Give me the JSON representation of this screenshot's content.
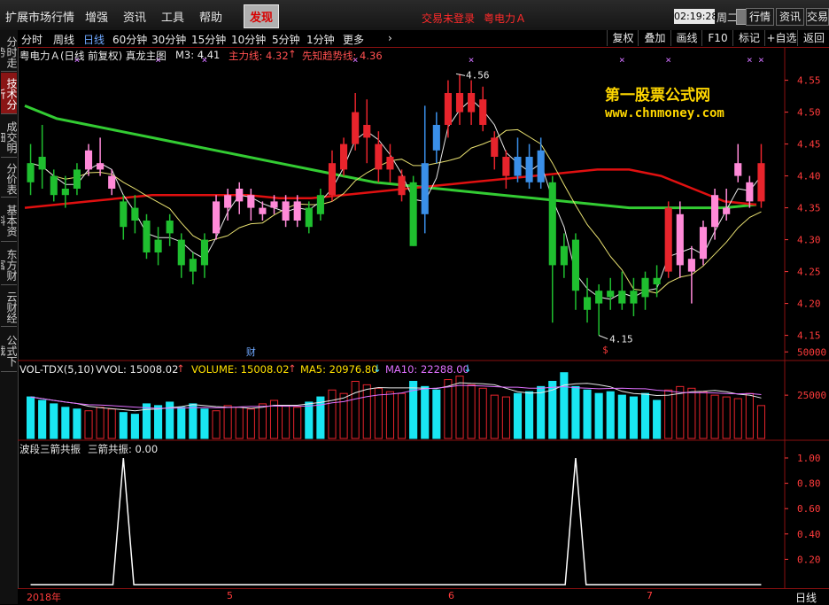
{
  "menu": {
    "items": [
      {
        "label": "扩展市场行情",
        "x": 6
      },
      {
        "label": "增强",
        "x": 96
      },
      {
        "label": "资讯",
        "x": 139
      },
      {
        "label": "工具",
        "x": 182
      },
      {
        "label": "帮助",
        "x": 225
      }
    ],
    "active_label": "发现",
    "status_not_logged": "交易未登录",
    "status_stock": "粤电力Ａ",
    "clock": "02:19:28",
    "weekday": "周二",
    "buttons": [
      "行情",
      "资讯",
      "交易"
    ]
  },
  "periods": {
    "items": [
      "分时",
      "周线",
      "日线",
      "60分钟",
      "30分钟",
      "15分钟",
      "10分钟",
      "5分钟",
      "1分钟",
      "更多"
    ],
    "selected": "日线",
    "more_arrow": "›",
    "tools": [
      "复权",
      "叠加",
      "画线",
      "F10",
      "标记",
      "+自选",
      "返回"
    ]
  },
  "left_tabs": [
    "分时走势",
    "技术分析",
    "成交明细",
    "分价表",
    "基本资料",
    "东方财富",
    "云财经",
    "公式下载"
  ],
  "left_tab_selected": "技术分析",
  "main_panel": {
    "title": "粤电力Ａ(日线 前复权) 真龙主图",
    "m3_label": "M3: 4.41",
    "main_line_label": "主力线: 4.32",
    "trend_line_label": "先知趋势线: 4.36",
    "arrow_up": "↑",
    "high_marker": "4.56",
    "low_marker": "4.15",
    "news_marker": "财",
    "s_marker": "$",
    "y_ticks": [
      "4.55",
      "4.50",
      "4.45",
      "4.40",
      "4.35",
      "4.30",
      "4.25",
      "4.20",
      "4.15"
    ]
  },
  "volume_panel": {
    "title": "VOL-TDX(5,10)",
    "vvol_label": "VVOL: 15008.02",
    "volume_label": "VOLUME: 15008.02",
    "ma5_label": "MA5: 20976.80",
    "ma10_label": "MA10: 22288.00",
    "arrow_up": "↑",
    "arrow_down": "↓",
    "y_ticks": [
      "50000",
      "25000"
    ]
  },
  "signal_panel": {
    "title": "波段三箭共振",
    "value_label": "三箭共振: 0.00",
    "y_ticks": [
      "1.00",
      "0.80",
      "0.60",
      "0.40",
      "0.20"
    ]
  },
  "date_axis": {
    "labels": [
      "2018年",
      "5",
      "6",
      "7"
    ],
    "period": "日线"
  },
  "watermark": {
    "line1": "第一股票公式网",
    "line2": "www.chnmoney.com"
  },
  "colors": {
    "up": "#e8242c",
    "down": "#1fbf2f",
    "pink": "#ff8ad8",
    "blue": "#3a8fe8",
    "axis_red": "#ff3b3b",
    "trend_green": "#33cc33",
    "trend_red": "#e01010",
    "ma_yellow": "#e8e070",
    "vol_cyan": "#19e6f2"
  },
  "chart_data": {
    "type": "candlestick",
    "ylim": [
      4.13,
      4.58
    ],
    "candles": [
      {
        "o": 4.39,
        "c": 4.42,
        "h": 4.45,
        "l": 4.37,
        "t": "d"
      },
      {
        "o": 4.43,
        "c": 4.41,
        "h": 4.48,
        "l": 4.38,
        "t": "d"
      },
      {
        "o": 4.4,
        "c": 4.37,
        "h": 4.41,
        "l": 4.36,
        "t": "d"
      },
      {
        "o": 4.37,
        "c": 4.38,
        "h": 4.4,
        "l": 4.35,
        "t": "d"
      },
      {
        "o": 4.38,
        "c": 4.41,
        "h": 4.42,
        "l": 4.37,
        "t": "d"
      },
      {
        "o": 4.41,
        "c": 4.44,
        "h": 4.45,
        "l": 4.4,
        "t": "p"
      },
      {
        "o": 4.42,
        "c": 4.41,
        "h": 4.46,
        "l": 4.4,
        "t": "p"
      },
      {
        "o": 4.4,
        "c": 4.38,
        "h": 4.41,
        "l": 4.37,
        "t": "p"
      },
      {
        "o": 4.36,
        "c": 4.32,
        "h": 4.37,
        "l": 4.3,
        "t": "d"
      },
      {
        "o": 4.35,
        "c": 4.33,
        "h": 4.37,
        "l": 4.31,
        "t": "d"
      },
      {
        "o": 4.33,
        "c": 4.28,
        "h": 4.34,
        "l": 4.27,
        "t": "d"
      },
      {
        "o": 4.28,
        "c": 4.3,
        "h": 4.32,
        "l": 4.26,
        "t": "d"
      },
      {
        "o": 4.31,
        "c": 4.33,
        "h": 4.34,
        "l": 4.29,
        "t": "d"
      },
      {
        "o": 4.3,
        "c": 4.26,
        "h": 4.31,
        "l": 4.24,
        "t": "d"
      },
      {
        "o": 4.27,
        "c": 4.25,
        "h": 4.28,
        "l": 4.23,
        "t": "d"
      },
      {
        "o": 4.26,
        "c": 4.3,
        "h": 4.31,
        "l": 4.24,
        "t": "d"
      },
      {
        "o": 4.31,
        "c": 4.36,
        "h": 4.37,
        "l": 4.3,
        "t": "p"
      },
      {
        "o": 4.35,
        "c": 4.37,
        "h": 4.38,
        "l": 4.33,
        "t": "p"
      },
      {
        "o": 4.36,
        "c": 4.38,
        "h": 4.39,
        "l": 4.34,
        "t": "p"
      },
      {
        "o": 4.37,
        "c": 4.35,
        "h": 4.38,
        "l": 4.33,
        "t": "p"
      },
      {
        "o": 4.35,
        "c": 4.34,
        "h": 4.36,
        "l": 4.33,
        "t": "p"
      },
      {
        "o": 4.35,
        "c": 4.36,
        "h": 4.37,
        "l": 4.34,
        "t": "p"
      },
      {
        "o": 4.36,
        "c": 4.33,
        "h": 4.37,
        "l": 4.32,
        "t": "p"
      },
      {
        "o": 4.33,
        "c": 4.36,
        "h": 4.37,
        "l": 4.32,
        "t": "p"
      },
      {
        "o": 4.32,
        "c": 4.35,
        "h": 4.36,
        "l": 4.31,
        "t": "d"
      },
      {
        "o": 4.34,
        "c": 4.37,
        "h": 4.38,
        "l": 4.33,
        "t": "d"
      },
      {
        "o": 4.37,
        "c": 4.42,
        "h": 4.44,
        "l": 4.36,
        "t": "u"
      },
      {
        "o": 4.41,
        "c": 4.45,
        "h": 4.46,
        "l": 4.4,
        "t": "u"
      },
      {
        "o": 4.45,
        "c": 4.5,
        "h": 4.53,
        "l": 4.44,
        "t": "u"
      },
      {
        "o": 4.48,
        "c": 4.46,
        "h": 4.52,
        "l": 4.42,
        "t": "u"
      },
      {
        "o": 4.45,
        "c": 4.41,
        "h": 4.47,
        "l": 4.39,
        "t": "u"
      },
      {
        "o": 4.41,
        "c": 4.43,
        "h": 4.45,
        "l": 4.39,
        "t": "u"
      },
      {
        "o": 4.4,
        "c": 4.37,
        "h": 4.41,
        "l": 4.36,
        "t": "u"
      },
      {
        "o": 4.39,
        "c": 4.29,
        "h": 4.4,
        "l": 4.29,
        "t": "d"
      },
      {
        "o": 4.34,
        "c": 4.42,
        "h": 4.51,
        "l": 4.31,
        "t": "b"
      },
      {
        "o": 4.44,
        "c": 4.48,
        "h": 4.5,
        "l": 4.42,
        "t": "b"
      },
      {
        "o": 4.48,
        "c": 4.53,
        "h": 4.55,
        "l": 4.46,
        "t": "u"
      },
      {
        "o": 4.53,
        "c": 4.5,
        "h": 4.56,
        "l": 4.48,
        "t": "u"
      },
      {
        "o": 4.5,
        "c": 4.53,
        "h": 4.55,
        "l": 4.48,
        "t": "u"
      },
      {
        "o": 4.52,
        "c": 4.48,
        "h": 4.54,
        "l": 4.47,
        "t": "u"
      },
      {
        "o": 4.46,
        "c": 4.43,
        "h": 4.47,
        "l": 4.41,
        "t": "u"
      },
      {
        "o": 4.43,
        "c": 4.4,
        "h": 4.44,
        "l": 4.38,
        "t": "u"
      },
      {
        "o": 4.4,
        "c": 4.43,
        "h": 4.46,
        "l": 4.39,
        "t": "b"
      },
      {
        "o": 4.43,
        "c": 4.39,
        "h": 4.45,
        "l": 4.38,
        "t": "b"
      },
      {
        "o": 4.39,
        "c": 4.44,
        "h": 4.46,
        "l": 4.38,
        "t": "b"
      },
      {
        "o": 4.39,
        "c": 4.26,
        "h": 4.4,
        "l": 4.17,
        "t": "d"
      },
      {
        "o": 4.29,
        "c": 4.26,
        "h": 4.31,
        "l": 4.24,
        "t": "d"
      },
      {
        "o": 4.3,
        "c": 4.22,
        "h": 4.31,
        "l": 4.19,
        "t": "d"
      },
      {
        "o": 4.21,
        "c": 4.19,
        "h": 4.24,
        "l": 4.17,
        "t": "d"
      },
      {
        "o": 4.2,
        "c": 4.22,
        "h": 4.23,
        "l": 4.15,
        "t": "d"
      },
      {
        "o": 4.22,
        "c": 4.21,
        "h": 4.24,
        "l": 4.19,
        "t": "d"
      },
      {
        "o": 4.2,
        "c": 4.22,
        "h": 4.25,
        "l": 4.19,
        "t": "d"
      },
      {
        "o": 4.22,
        "c": 4.2,
        "h": 4.24,
        "l": 4.18,
        "t": "d"
      },
      {
        "o": 4.21,
        "c": 4.24,
        "h": 4.25,
        "l": 4.19,
        "t": "d"
      },
      {
        "o": 4.24,
        "c": 4.23,
        "h": 4.26,
        "l": 4.21,
        "t": "d"
      },
      {
        "o": 4.25,
        "c": 4.35,
        "h": 4.36,
        "l": 4.24,
        "t": "u"
      },
      {
        "o": 4.34,
        "c": 4.26,
        "h": 4.36,
        "l": 4.24,
        "t": "p"
      },
      {
        "o": 4.27,
        "c": 4.25,
        "h": 4.29,
        "l": 4.2,
        "t": "p"
      },
      {
        "o": 4.27,
        "c": 4.32,
        "h": 4.33,
        "l": 4.26,
        "t": "p"
      },
      {
        "o": 4.32,
        "c": 4.37,
        "h": 4.38,
        "l": 4.3,
        "t": "p"
      },
      {
        "o": 4.34,
        "c": 4.35,
        "h": 4.38,
        "l": 4.33,
        "t": "p"
      },
      {
        "o": 4.4,
        "c": 4.42,
        "h": 4.45,
        "l": 4.39,
        "t": "p"
      },
      {
        "o": 4.39,
        "c": 4.36,
        "h": 4.4,
        "l": 4.35,
        "t": "p"
      },
      {
        "o": 4.36,
        "c": 4.42,
        "h": 4.45,
        "l": 4.35,
        "t": "u"
      }
    ],
    "green_trend": [
      4.51,
      4.49,
      4.48,
      4.47,
      4.46,
      4.45,
      4.44,
      4.43,
      4.42,
      4.41,
      4.4,
      4.39,
      4.385,
      4.38,
      4.375,
      4.37,
      4.365,
      4.36,
      4.355,
      4.35,
      4.35,
      4.35,
      4.35,
      4.355
    ],
    "red_trend": [
      4.35,
      4.355,
      4.36,
      4.365,
      4.37,
      4.37,
      4.37,
      4.37,
      4.365,
      4.365,
      4.37,
      4.375,
      4.38,
      4.385,
      4.39,
      4.395,
      4.4,
      4.405,
      4.41,
      4.41,
      4.4,
      4.38,
      4.36,
      4.355
    ],
    "volume": [
      24,
      22,
      20,
      18,
      17,
      16,
      18,
      17,
      15,
      14,
      20,
      19,
      21,
      18,
      20,
      17,
      16,
      19,
      18,
      17,
      20,
      22,
      19,
      18,
      21,
      24,
      28,
      26,
      33,
      31,
      29,
      27,
      26,
      33,
      30,
      28,
      34,
      36,
      31,
      29,
      25,
      24,
      26,
      27,
      30,
      33,
      38,
      30,
      28,
      26,
      27,
      25,
      24,
      26,
      22,
      28,
      30,
      29,
      27,
      25,
      24,
      23,
      26,
      19
    ],
    "volume_type": [
      "d",
      "d",
      "d",
      "d",
      "d",
      "p",
      "p",
      "p",
      "d",
      "d",
      "d",
      "d",
      "d",
      "d",
      "d",
      "d",
      "p",
      "p",
      "p",
      "p",
      "p",
      "p",
      "p",
      "p",
      "d",
      "d",
      "u",
      "u",
      "u",
      "u",
      "u",
      "u",
      "u",
      "d",
      "b",
      "b",
      "u",
      "u",
      "u",
      "u",
      "u",
      "u",
      "b",
      "b",
      "b",
      "d",
      "d",
      "d",
      "d",
      "d",
      "d",
      "d",
      "d",
      "d",
      "d",
      "u",
      "p",
      "p",
      "p",
      "p",
      "p",
      "p",
      "p",
      "u"
    ],
    "signal_peaks": [
      0.0,
      1.0
    ]
  }
}
